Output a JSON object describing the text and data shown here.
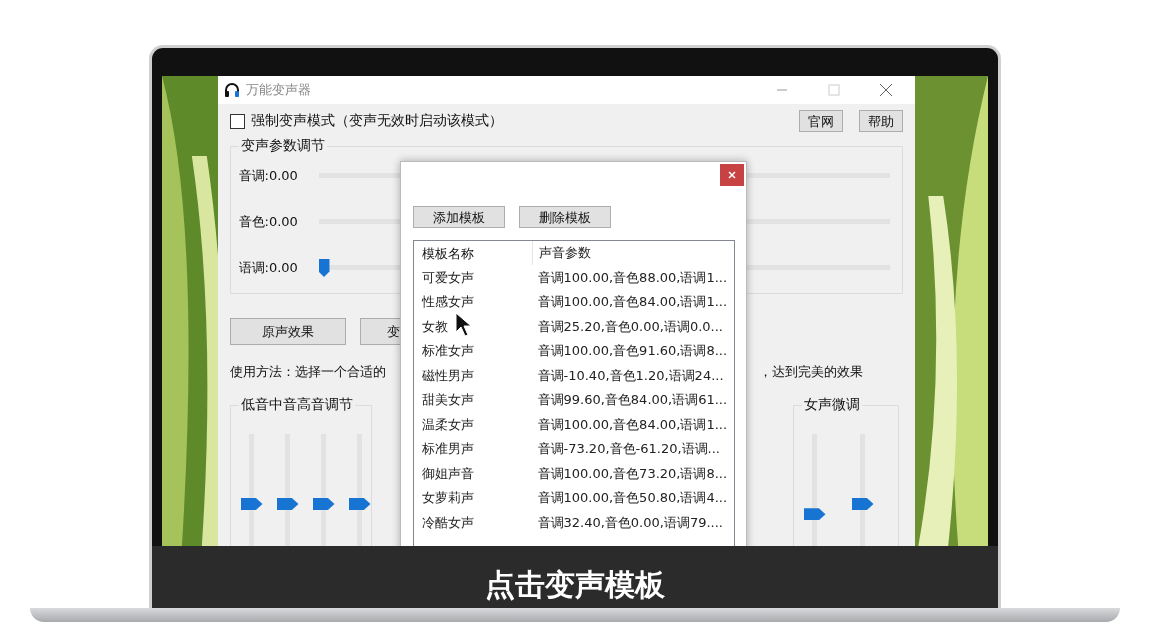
{
  "window": {
    "title": "万能变声器"
  },
  "force_mode": {
    "label": "强制变声模式（变声无效时启动该模式）",
    "checked": false
  },
  "top_buttons": [
    "官网",
    "帮助"
  ],
  "params_group": {
    "title": "变声参数调节",
    "sliders": [
      {
        "label": "音调:0.00"
      },
      {
        "label": "音色:0.00"
      },
      {
        "label": "语调:0.00",
        "level": 0
      }
    ]
  },
  "action_buttons": [
    "原声效果",
    "变"
  ],
  "usage": {
    "left": "使用方法：选择一个合适的",
    "right": "，达到完美的效果"
  },
  "eq_group": {
    "title": "低音中音高音调节",
    "sliders": [
      {
        "level": 0.5
      },
      {
        "level": 0.5
      },
      {
        "level": 0.5
      },
      {
        "level": 0.5
      }
    ]
  },
  "female_group": {
    "title": "女声微调",
    "sliders": [
      {
        "level": 0.42
      },
      {
        "level": 0.5
      }
    ]
  },
  "template_dialog": {
    "buttons": [
      "添加模板",
      "删除模板"
    ],
    "columns": [
      "模板名称",
      "声音参数"
    ],
    "rows": [
      [
        "可爱女声",
        "音调100.00,音色88.00,语调1..."
      ],
      [
        "性感女声",
        "音调100.00,音色84.00,语调1..."
      ],
      [
        "女教",
        "音调25.20,音色0.00,语调0.0..."
      ],
      [
        "标准女声",
        "音调100.00,音色91.60,语调8..."
      ],
      [
        "磁性男声",
        "音调-10.40,音色1.20,语调24..."
      ],
      [
        "甜美女声",
        "音调99.60,音色84.00,语调61..."
      ],
      [
        "温柔女声",
        "音调100.00,音色84.00,语调1..."
      ],
      [
        "标准男声",
        "音调-73.20,音色-61.20,语调..."
      ],
      [
        "御姐声音",
        "音调100.00,音色73.20,语调8..."
      ],
      [
        "女萝莉声",
        "音调100.00,音色50.80,语调4..."
      ],
      [
        "冷酷女声",
        "音调32.40,音色0.00,语调79...."
      ]
    ]
  },
  "caption": "点击变声模板"
}
